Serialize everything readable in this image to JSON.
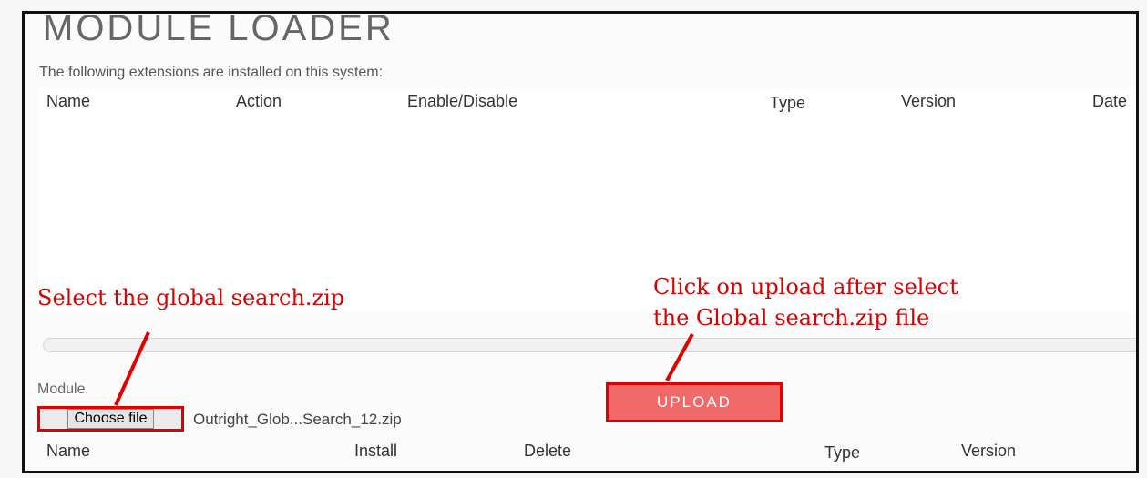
{
  "header": {
    "title": "MODULE LOADER",
    "subtitle": "The following extensions are installed on this system:"
  },
  "installed_table": {
    "columns": [
      "Name",
      "Action",
      "Enable/Disable",
      "Type",
      "Version",
      "Date"
    ]
  },
  "annotations": {
    "left": "Select the global search.zip",
    "right_line1": "Click on upload after select",
    "right_line2": "the Global search.zip file"
  },
  "upload_form": {
    "module_label": "Module",
    "choose_file_label": "Choose file",
    "selected_file": "Outright_Glob...Search_12.zip",
    "upload_label": "UPLOAD"
  },
  "upload_table": {
    "columns": [
      "Name",
      "Install",
      "Delete",
      "Type",
      "Version"
    ]
  },
  "colors": {
    "annotation_red": "#d90000",
    "upload_button": "#f06a6a"
  }
}
